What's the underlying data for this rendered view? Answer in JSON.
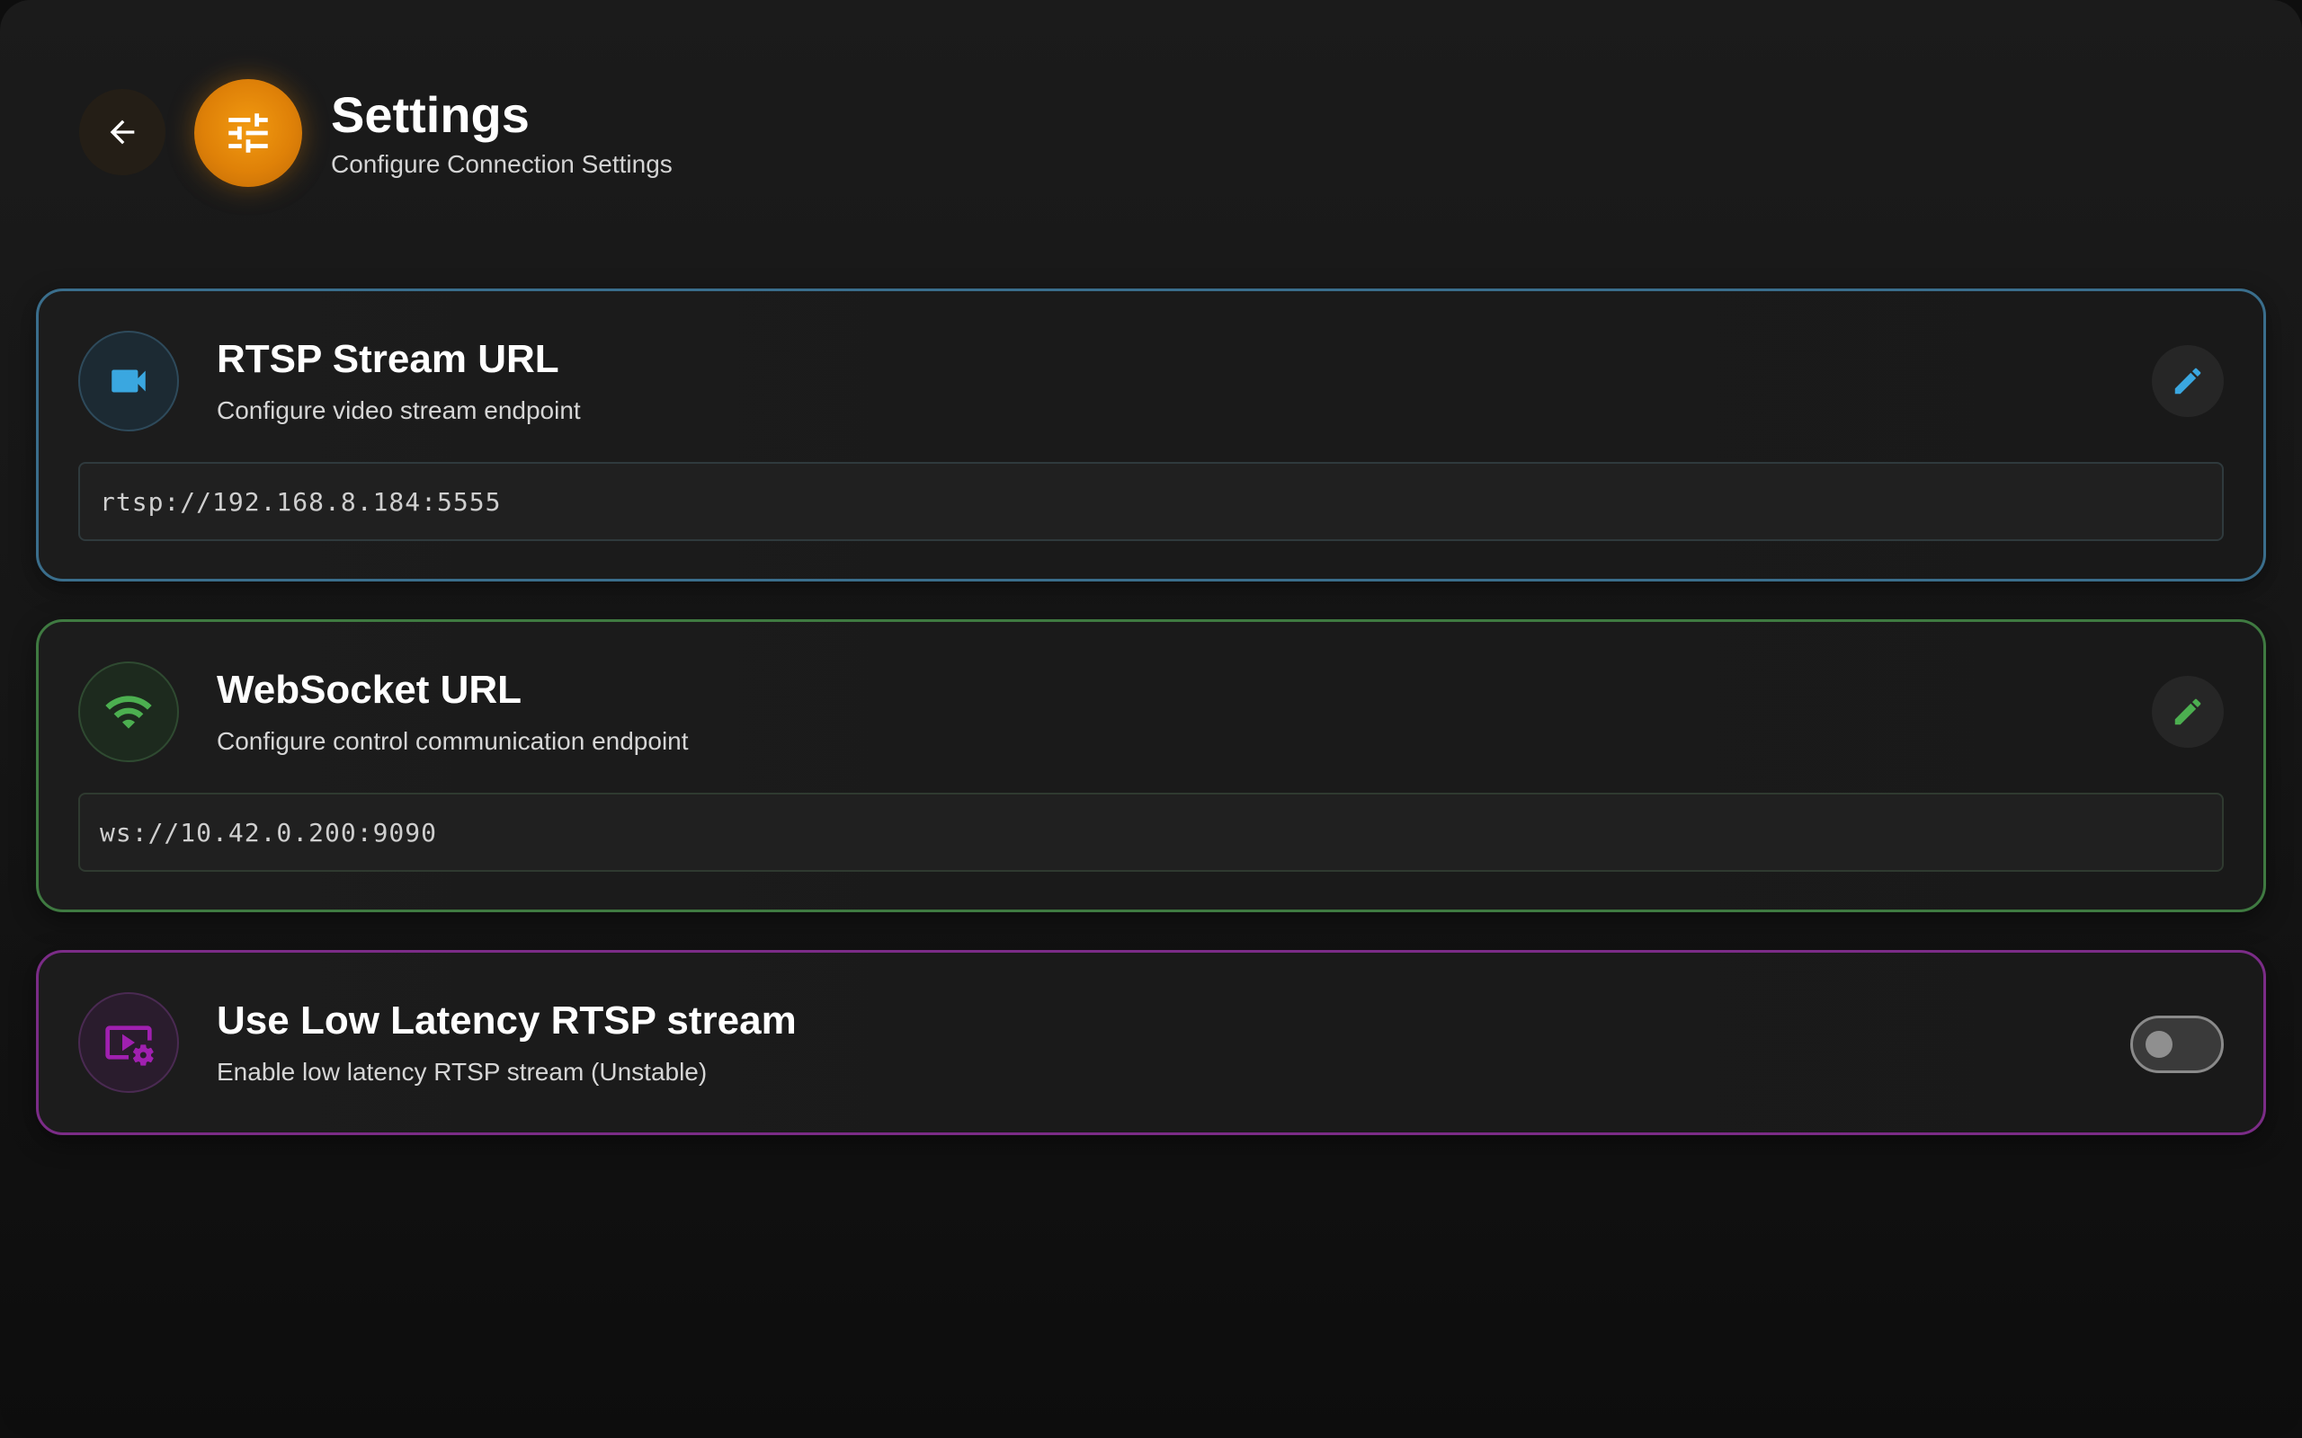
{
  "header": {
    "title": "Settings",
    "subtitle": "Configure Connection Settings",
    "back_icon": "arrow-left-icon",
    "settings_icon": "tune-sliders-icon",
    "accent_color": "#e88a0c"
  },
  "cards": [
    {
      "title": "RTSP Stream URL",
      "description": "Configure video stream endpoint",
      "value": "rtsp://192.168.8.184:5555",
      "icon": "videocam-icon",
      "accent_color": "#3aa7e0",
      "action_icon": "edit-icon"
    },
    {
      "title": "WebSocket URL",
      "description": "Configure control communication endpoint",
      "value": "ws://10.42.0.200:9090",
      "icon": "wifi-icon",
      "accent_color": "#4caf50",
      "action_icon": "edit-icon"
    },
    {
      "title": "Use Low Latency RTSP stream",
      "description": "Enable low latency RTSP stream (Unstable)",
      "icon": "video-settings-icon",
      "accent_color": "#a020b0",
      "toggle_on": false
    }
  ]
}
